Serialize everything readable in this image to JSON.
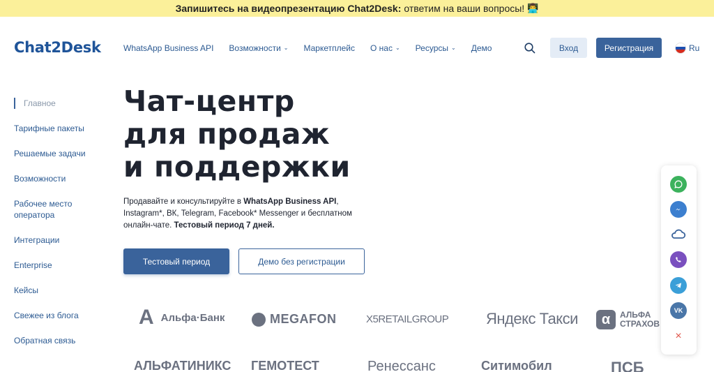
{
  "banner": {
    "bold_text": "Запишитесь на видеопрезентацию Chat2Desk:",
    "text": "ответим на ваши вопросы!",
    "emoji": "👨‍💻"
  },
  "header": {
    "logo": "Chat2Desk",
    "nav": [
      {
        "label": "WhatsApp Business API",
        "has_dropdown": false
      },
      {
        "label": "Возможности",
        "has_dropdown": true
      },
      {
        "label": "Маркетплейс",
        "has_dropdown": false
      },
      {
        "label": "О нас",
        "has_dropdown": true
      },
      {
        "label": "Ресурсы",
        "has_dropdown": true
      },
      {
        "label": "Демо",
        "has_dropdown": false
      }
    ],
    "login": "Вход",
    "register": "Регистрация",
    "language": "Ru"
  },
  "sidebar": {
    "items": [
      {
        "label": "Главное",
        "active": true
      },
      {
        "label": "Тарифные пакеты"
      },
      {
        "label": "Решаемые задачи"
      },
      {
        "label": "Возможности"
      },
      {
        "label": "Рабочее место оператора"
      },
      {
        "label": "Интеграции"
      },
      {
        "label": "Enterprise"
      },
      {
        "label": "Кейсы"
      },
      {
        "label": "Свежее из блога"
      },
      {
        "label": "Обратная связь"
      }
    ]
  },
  "hero": {
    "title_lines": [
      "Чат-центр",
      "для продаж",
      "и поддержки"
    ],
    "text_1": "Продавайте и консультируйте в ",
    "text_bold_1": "WhatsApp Business API",
    "text_2": ", Instagram*, ВК, Telegram, Facebook* Messenger и бесплатном онлайн-чате. ",
    "text_bold_2": "Тестовый период 7 дней.",
    "trial_button": "Тестовый период",
    "demo_button": "Демо без регистрации"
  },
  "clients": {
    "row1": [
      "Альфа·Банк",
      "MEGAFON",
      "X5RETAILGROUP",
      "Яндекс Такси",
      "АЛЬФА СТРАХОВ"
    ],
    "row2": [
      "АЛЬФАТИНИКС",
      "ГЕМОТЕСТ",
      "Ренессанс",
      "Ситимобил",
      "ПСБ"
    ]
  },
  "widget": {
    "icons": [
      "whatsapp-icon",
      "messenger-icon",
      "online-chat-icon",
      "viber-icon",
      "telegram-icon",
      "vk-icon",
      "close-icon"
    ],
    "colors": {
      "whatsapp": "#3cb25d",
      "messenger": "#3c7fcf",
      "chat": "#3a639b",
      "viber": "#7a50bf",
      "telegram": "#3b9fd8",
      "vk": "#4a76a8",
      "close": "#e0564b"
    },
    "vk_label": "VK"
  },
  "colors": {
    "brand": "#3a639b",
    "link": "#2c5a92",
    "banner_bg": "#fbf09a"
  }
}
